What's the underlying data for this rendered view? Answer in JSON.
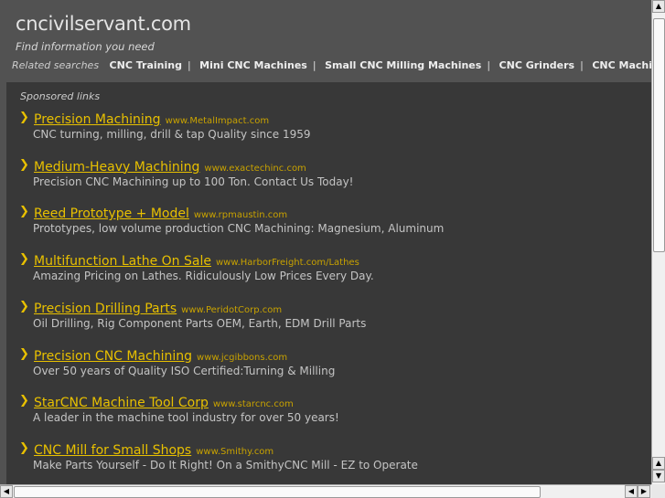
{
  "site": {
    "title": "cncivilservant.com",
    "tagline": "Find information you need"
  },
  "related": {
    "label": "Related searches",
    "items": [
      "CNC Training",
      "Mini CNC Machines",
      "Small CNC Milling Machines",
      "CNC Grinders",
      "CNC Machine Tool Manufacturers"
    ]
  },
  "sponsored_label": "Sponsored links",
  "ads": [
    {
      "title": "Precision Machining",
      "url": "www.MetalImpact.com",
      "desc": "CNC turning, milling, drill & tap Quality since 1959"
    },
    {
      "title": "Medium-Heavy Machining",
      "url": "www.exactechinc.com",
      "desc": "Precision CNC Machining up to 100 Ton. Contact Us Today!"
    },
    {
      "title": "Reed Prototype + Model",
      "url": "www.rpmaustin.com",
      "desc": "Prototypes, low volume production CNC Machining: Magnesium, Aluminum"
    },
    {
      "title": "Multifunction Lathe On Sale",
      "url": "www.HarborFreight.com/Lathes",
      "desc": "Amazing Pricing on Lathes. Ridiculously Low Prices Every Day."
    },
    {
      "title": "Precision Drilling Parts",
      "url": "www.PeridotCorp.com",
      "desc": "Oil Drilling, Rig Component Parts OEM, Earth, EDM Drill Parts"
    },
    {
      "title": "Precision CNC Machining",
      "url": "www.jcgibbons.com",
      "desc": "Over 50 years of Quality ISO Certified:Turning & Milling"
    },
    {
      "title": "StarCNC Machine Tool Corp",
      "url": "www.starcnc.com",
      "desc": "A leader in the machine tool industry for over 50 years!"
    },
    {
      "title": "CNC Mill for Small Shops",
      "url": "www.Smithy.com",
      "desc": "Make Parts Yourself - Do It Right! On a SmithyCNC Mill - EZ to Operate"
    }
  ]
}
